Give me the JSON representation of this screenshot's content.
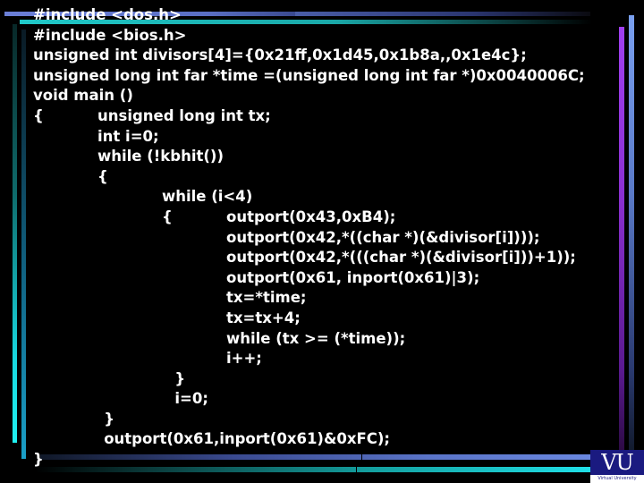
{
  "slide": {
    "code_lines": [
      {
        "indent": 0,
        "text": "#include <dos.h>"
      },
      {
        "indent": 0,
        "text": "#include <bios.h>"
      },
      {
        "indent": 0,
        "text": "unsigned int divisors[4]={0x21ff,0x1d45,0x1b8a,,0x1e4c};"
      },
      {
        "indent": 0,
        "text": "unsigned long int far *time =(unsigned long int far *)0x0040006C;"
      },
      {
        "indent": 0,
        "text": "void main ()"
      },
      {
        "indent": 0,
        "text": "{",
        "tail_indent": 1,
        "tail": "unsigned long int tx;"
      },
      {
        "indent": 1,
        "text": "int i=0;"
      },
      {
        "indent": 1,
        "text": "while (!kbhit())"
      },
      {
        "indent": 1,
        "text": "{"
      },
      {
        "indent": 2,
        "text": "while (i<4)"
      },
      {
        "indent": 2,
        "text": "{",
        "tail_indent": 3,
        "tail": "outport(0x43,0xB4);"
      },
      {
        "indent": 3,
        "text": "outport(0x42,*((char *)(&divisor[i])));"
      },
      {
        "indent": 3,
        "text": "outport(0x42,*(((char *)(&divisor[i]))+1));"
      },
      {
        "indent": 3,
        "text": "outport(0x61, inport(0x61)|3);"
      },
      {
        "indent": 3,
        "text": "tx=*time;"
      },
      {
        "indent": 3,
        "text": "tx=tx+4;"
      },
      {
        "indent": 3,
        "text": "while (tx >= (*time));"
      },
      {
        "indent": 3,
        "text": "i++;"
      },
      {
        "indent": 2.2,
        "text": "}"
      },
      {
        "indent": 2.2,
        "text": "i=0;"
      },
      {
        "indent": 1.1,
        "text": "}"
      },
      {
        "indent": 1.1,
        "text": "outport(0x61,inport(0x61)&0xFC);"
      },
      {
        "indent": 0,
        "text": "}"
      }
    ]
  },
  "logo": {
    "mark": "VU",
    "caption": "Virtual University"
  },
  "colors": {
    "background": "#000000",
    "text": "#ffffff",
    "logo_blue": "#1a1a80"
  }
}
